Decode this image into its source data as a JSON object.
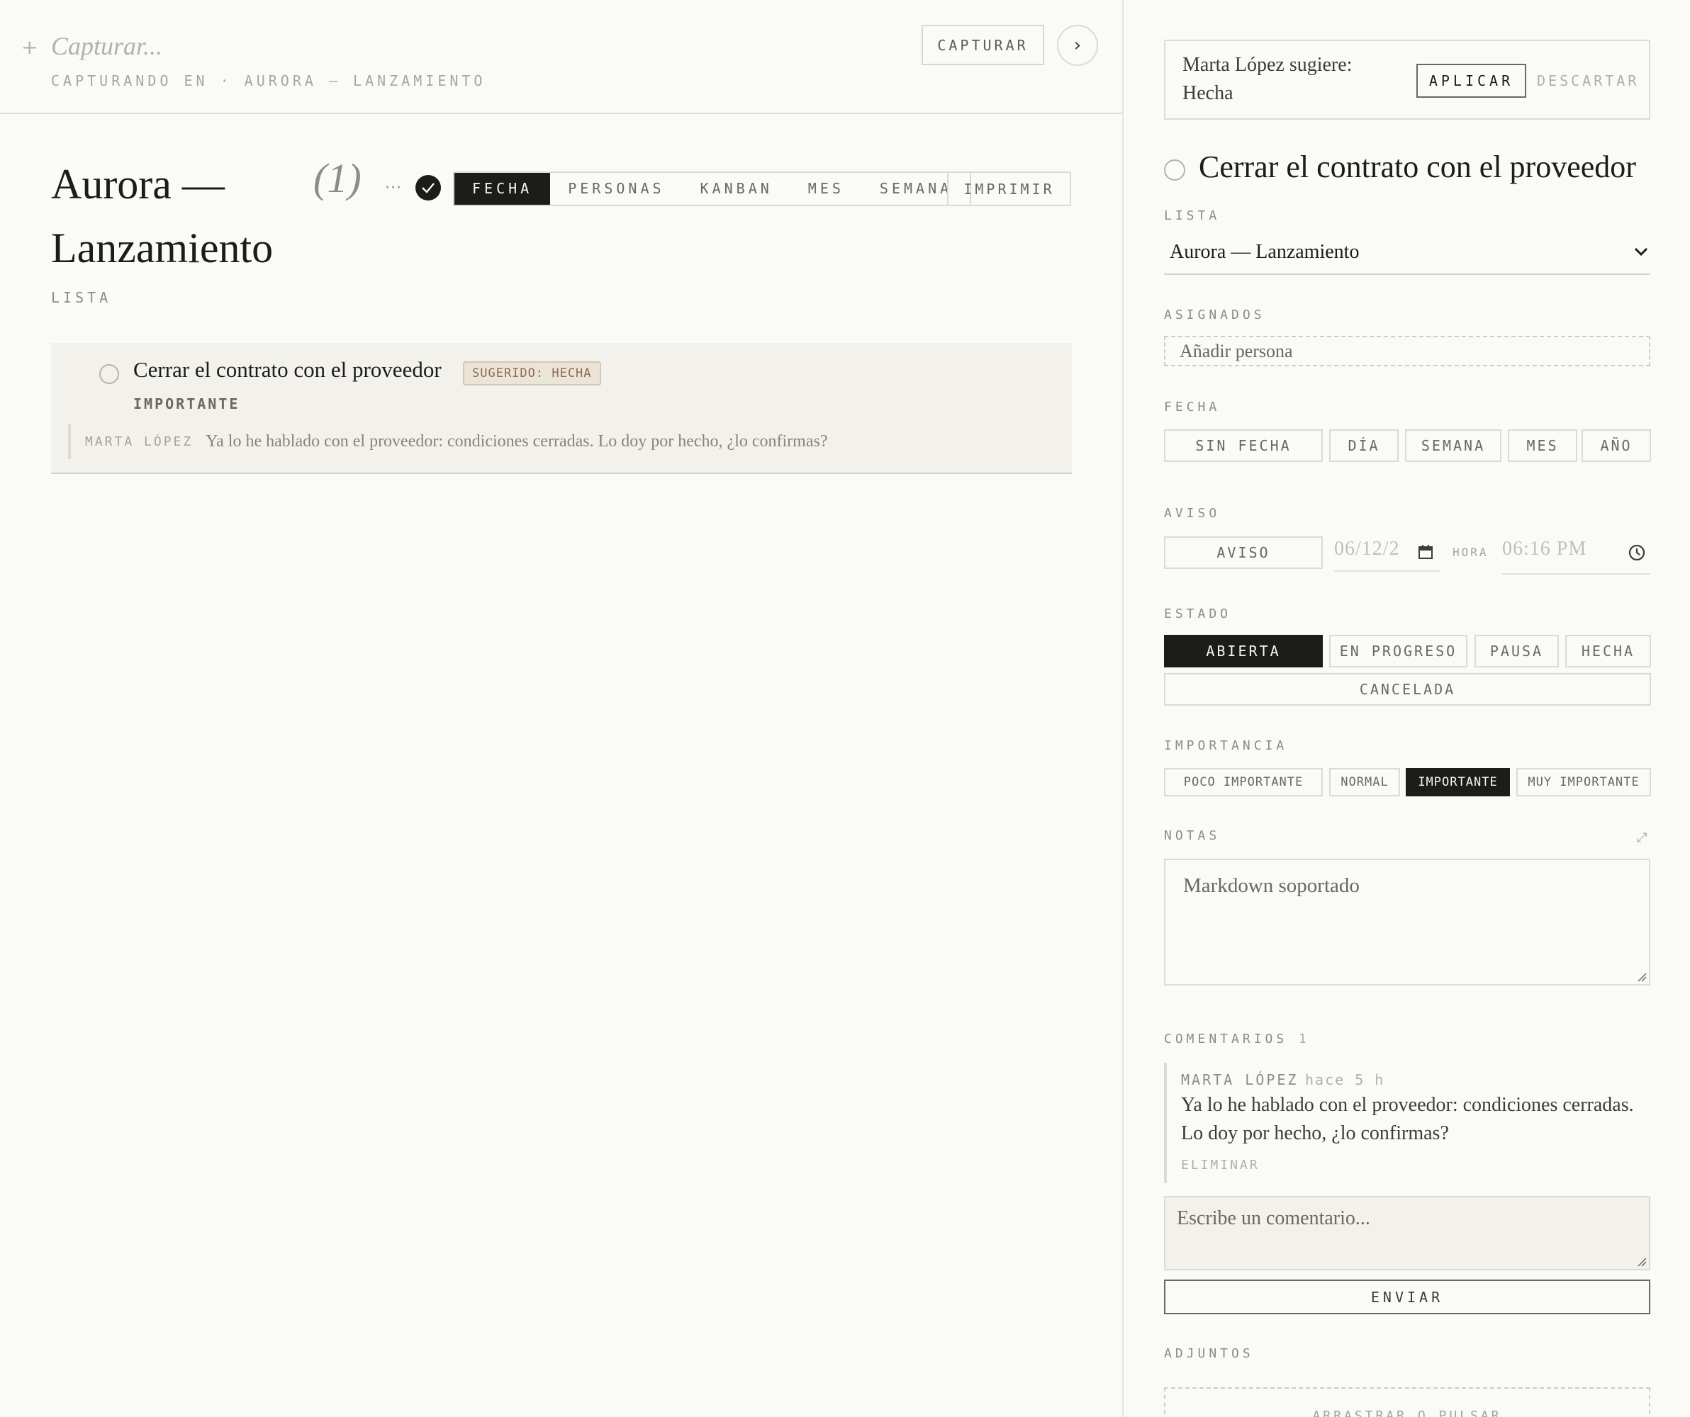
{
  "capture": {
    "placeholder": "Capturar...",
    "hint": "CAPTURANDO EN · AURORA — LANZAMIENTO",
    "button": "CAPTURAR",
    "next": "›"
  },
  "list": {
    "title": "Aurora — Lanzamiento",
    "count": "(1)",
    "subtitle": "LISTA",
    "more": "···",
    "tabs": [
      "FECHA",
      "PERSONAS",
      "KANBAN",
      "MES",
      "SEMANA"
    ],
    "active_tab": "FECHA",
    "print": "IMPRIMIR"
  },
  "task": {
    "title": "Cerrar el contrato con el proveedor",
    "badge": "SUGERIDO: HECHA",
    "priority": "IMPORTANTE",
    "comment_author": "MARTA LÓPEZ",
    "comment_text": "Ya lo he hablado con el proveedor: condiciones cerradas. Lo doy por hecho, ¿lo confirmas?"
  },
  "detail": {
    "suggestion": {
      "line1": "Marta López sugiere:",
      "line2": "Hecha",
      "apply": "APLICAR",
      "discard": "DESCARTAR"
    },
    "title": "Cerrar el contrato con el proveedor",
    "lista_label": "LISTA",
    "lista_value": "Aurora — Lanzamiento",
    "asignados_label": "ASIGNADOS",
    "add_person_placeholder": "Añadir persona",
    "fecha_label": "FECHA",
    "fecha_options": [
      "SIN FECHA",
      "DÍA",
      "SEMANA",
      "MES",
      "AÑO"
    ],
    "aviso_label": "AVISO",
    "aviso_button": "AVISO",
    "aviso_date": "06/12/2",
    "hora_label": "HORA",
    "aviso_time": "06:16 PM",
    "estado_label": "ESTADO",
    "estado_options": [
      "ABIERTA",
      "EN PROGRESO",
      "PAUSA",
      "HECHA"
    ],
    "estado_cancel": "CANCELADA",
    "estado_active": "ABIERTA",
    "importancia_label": "IMPORTANCIA",
    "importancia_options": [
      "POCO IMPORTANTE",
      "NORMAL",
      "IMPORTANTE",
      "MUY IMPORTANTE"
    ],
    "importancia_active": "IMPORTANTE",
    "notas_label": "NOTAS",
    "notas_placeholder": "Markdown soportado",
    "comentarios_label": "COMENTARIOS",
    "comentarios_count": "1",
    "comment": {
      "author": "MARTA LÓPEZ",
      "time": "hace 5 h",
      "text": "Ya lo he hablado con el proveedor: condiciones cerradas. Lo doy por hecho, ¿lo confirmas?",
      "delete": "ELIMINAR"
    },
    "comment_placeholder": "Escribe un comentario...",
    "send": "ENVIAR",
    "adjuntos_label": "ADJUNTOS",
    "dropzone": "ARRASTRAR O PULSAR"
  },
  "colors": {
    "background": "#fafaf6",
    "ink": "#1c1c1a",
    "badge_bg": "#ede4d8",
    "badge_text": "#8a6c4f"
  }
}
